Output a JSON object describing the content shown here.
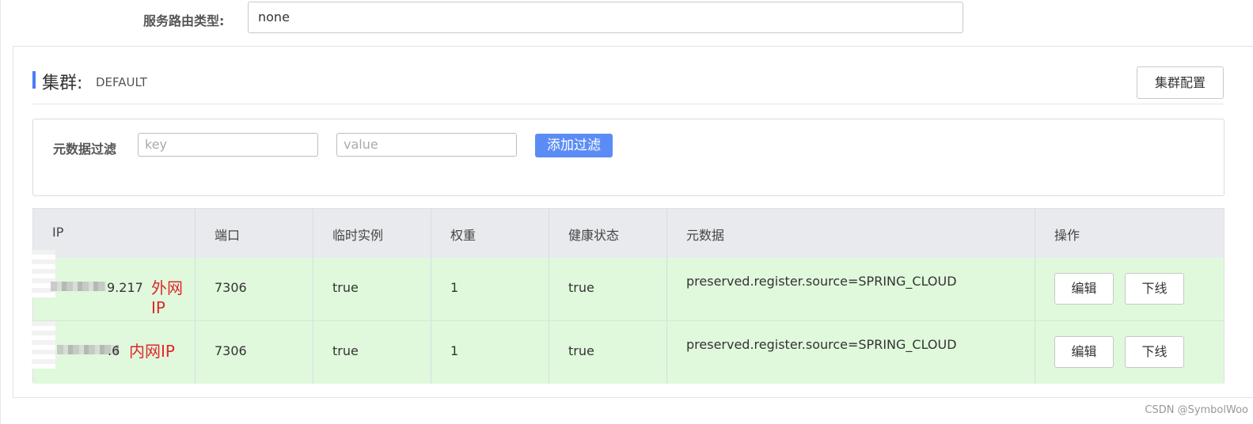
{
  "route": {
    "label": "服务路由类型:",
    "value": "none"
  },
  "cluster": {
    "title": "集群:",
    "name": "DEFAULT",
    "config_button": "集群配置"
  },
  "filter": {
    "label": "元数据过滤",
    "key_placeholder": "key",
    "value_placeholder": "value",
    "add_button": "添加过滤"
  },
  "table": {
    "headers": [
      "IP",
      "端口",
      "临时实例",
      "权重",
      "健康状态",
      "元数据",
      "操作"
    ],
    "rows": [
      {
        "ip_suffix": "9.217",
        "ip_note": "外网IP",
        "port": "7306",
        "ephemeral": "true",
        "weight": "1",
        "healthy": "true",
        "metadata": "preserved.register.source=SPRING_CLOUD",
        "edit": "编辑",
        "offline": "下线"
      },
      {
        "ip_suffix": ".6",
        "ip_note": "内网IP",
        "port": "7306",
        "ephemeral": "true",
        "weight": "1",
        "healthy": "true",
        "metadata": "preserved.register.source=SPRING_CLOUD",
        "edit": "编辑",
        "offline": "下线"
      }
    ]
  },
  "watermark": "CSDN @SymbolWoo"
}
